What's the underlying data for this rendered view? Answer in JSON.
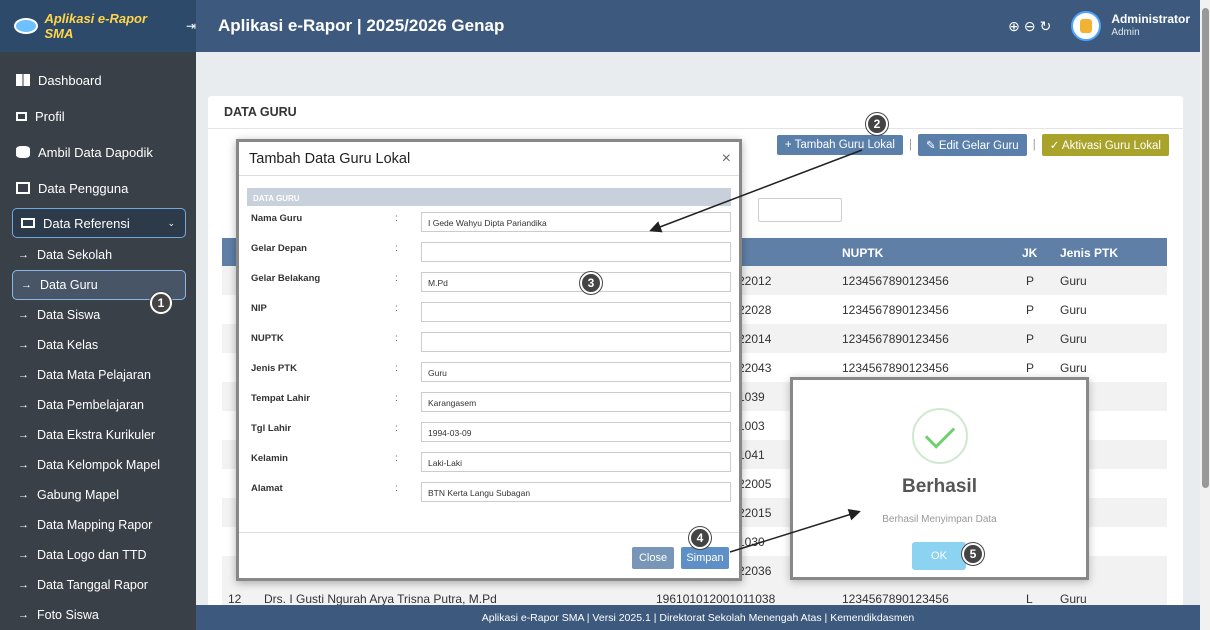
{
  "brand": {
    "name": "Aplikasi e-Rapor SMA",
    "pin": "⇥"
  },
  "header": {
    "title": "Aplikasi e-Rapor | 2025/2026 Genap",
    "user_name": "Administrator",
    "user_role": "Admin"
  },
  "sidebar": {
    "items": [
      {
        "label": "Dashboard",
        "icon": "dashboard-icon"
      },
      {
        "label": "Profil",
        "icon": "profile-icon"
      },
      {
        "label": "Ambil Data Dapodik",
        "icon": "database-icon"
      },
      {
        "label": "Data Pengguna",
        "icon": "users-icon"
      }
    ],
    "active_group": "Data Referensi",
    "subitems": [
      "Data Sekolah",
      "Data Guru",
      "Data Siswa",
      "Data Kelas",
      "Data Mata Pelajaran",
      "Data Pembelajaran",
      "Data Ekstra Kurikuler",
      "Data Kelompok Mapel",
      "Gabung Mapel",
      "Data Mapping Rapor",
      "Data Logo dan TTD",
      "Data Tanggal Rapor",
      "Foto Siswa"
    ]
  },
  "page": {
    "title": "DATA GURU",
    "btn_tambah": "Tambah Guru Lokal",
    "btn_edit": "Edit Gelar Guru",
    "btn_aktivasi": "Aktivasi Guru Lokal",
    "columns": {
      "nuptk": "NUPTK",
      "jk": "JK",
      "jenis": "Jenis PTK"
    },
    "rows": [
      {
        "nip": "22012",
        "nuptk": "1234567890123456",
        "jk": "P",
        "jenis": "Guru"
      },
      {
        "nip": "22028",
        "nuptk": "1234567890123456",
        "jk": "P",
        "jenis": "Guru"
      },
      {
        "nip": "22014",
        "nuptk": "1234567890123456",
        "jk": "P",
        "jenis": "Guru"
      },
      {
        "nip": "22043",
        "nuptk": "1234567890123456",
        "jk": "P",
        "jenis": "Guru"
      },
      {
        "nip": "1039",
        "nuptk": "",
        "jk": "",
        "jenis": ""
      },
      {
        "nip": "1003",
        "nuptk": "",
        "jk": "",
        "jenis": ""
      },
      {
        "nip": "1041",
        "nuptk": "",
        "jk": "",
        "jenis": ""
      },
      {
        "nip": "22005",
        "nuptk": "",
        "jk": "",
        "jenis": ""
      },
      {
        "nip": "22015",
        "nuptk": "",
        "jk": "",
        "jenis": ""
      },
      {
        "nip": "1030",
        "nuptk": "",
        "jk": "",
        "jenis": ""
      },
      {
        "nip": "22036",
        "nuptk": "",
        "jk": "",
        "jenis": ""
      }
    ],
    "last_row": {
      "no": "12",
      "nama": "Drs. I Gusti Ngurah Arya Trisna Putra, M.Pd",
      "nip": "196101012001011038",
      "nuptk": "1234567890123456",
      "jk": "L",
      "jenis": "Guru"
    }
  },
  "modal": {
    "title": "Tambah Data Guru Lokal",
    "close": "×",
    "section": "DATA GURU",
    "fields": [
      {
        "label": "Nama Guru",
        "value": "I Gede Wahyu Dipta Pariandika"
      },
      {
        "label": "Gelar Depan",
        "value": ""
      },
      {
        "label": "Gelar Belakang",
        "value": "M.Pd"
      },
      {
        "label": "NIP",
        "value": ""
      },
      {
        "label": "NUPTK",
        "value": ""
      },
      {
        "label": "Jenis PTK",
        "value": "Guru"
      },
      {
        "label": "Tempat Lahir",
        "value": "Karangasem"
      },
      {
        "label": "Tgl Lahir",
        "value": "1994-03-09"
      },
      {
        "label": "Kelamin",
        "value": "Laki-Laki"
      },
      {
        "label": "Alamat",
        "value": "BTN Kerta Langu Subagan"
      }
    ],
    "colon": ":",
    "btn_close": "Close",
    "btn_save": "Simpan"
  },
  "popup": {
    "title": "Berhasil",
    "message": "Berhasil Menyimpan Data",
    "ok": "OK"
  },
  "badges": [
    "1",
    "2",
    "3",
    "4",
    "5"
  ],
  "footer": "Aplikasi e-Rapor SMA | Versi 2025.1 | Direktorat Sekolah Menengah Atas | Kemendikdasmen"
}
